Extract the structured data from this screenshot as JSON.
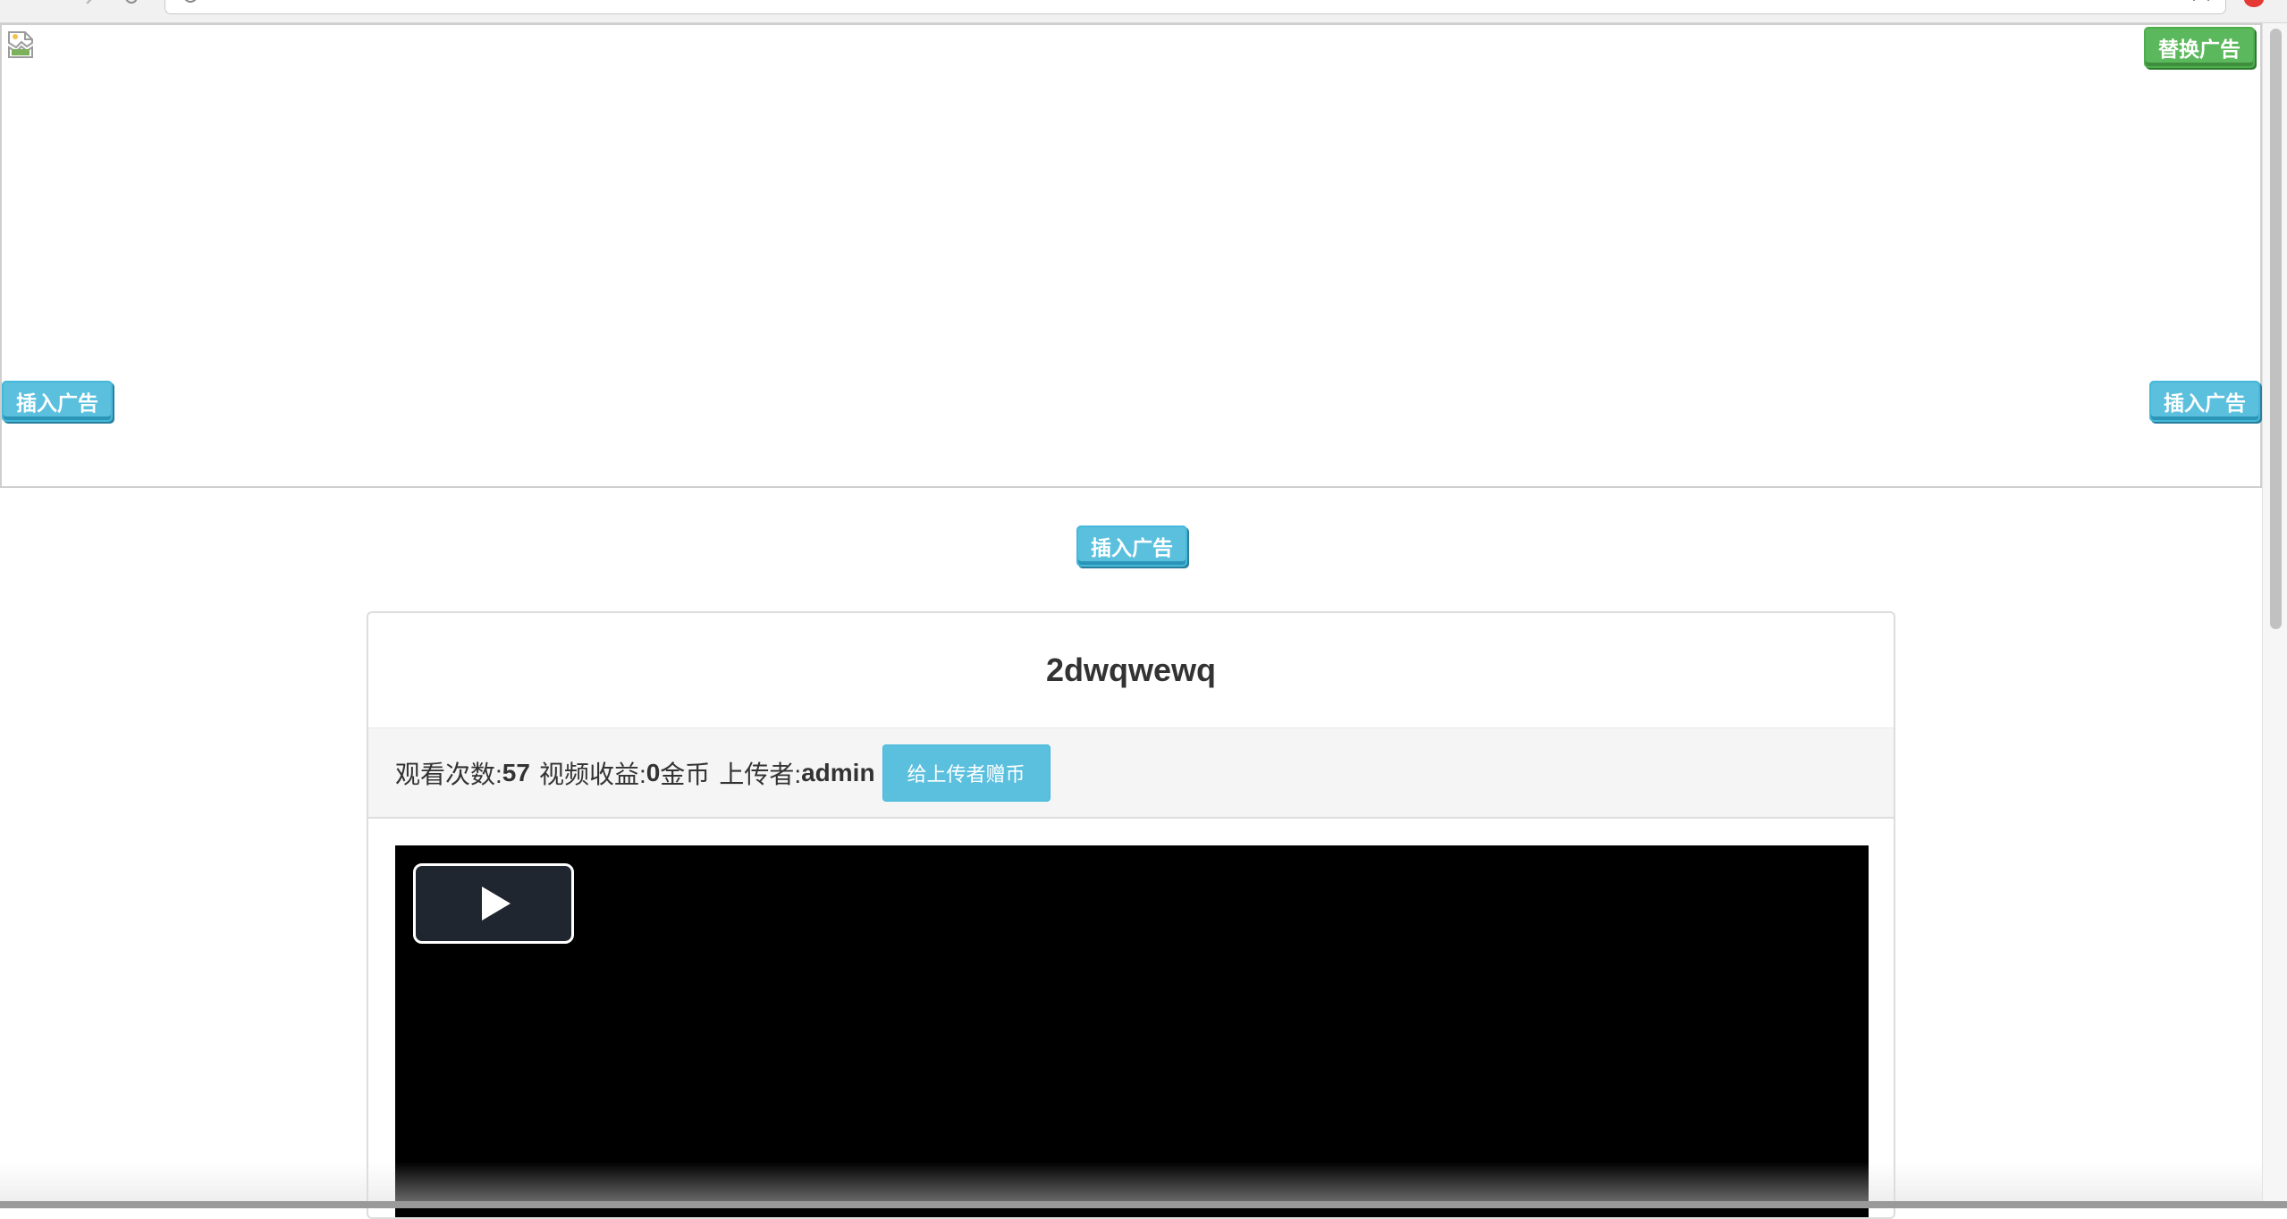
{
  "ad": {
    "replace_label": "替换广告",
    "insert_left_label": "插入广告",
    "insert_right_label": "插入广告",
    "insert_center_label": "插入广告"
  },
  "video": {
    "title": "2dwqwewq",
    "views_label": "观看次数:",
    "views_value": "57",
    "revenue_label": "视频收益:",
    "revenue_value": "0",
    "revenue_unit": "金币",
    "uploader_label": "上传者:",
    "uploader_value": "admin",
    "tip_button_label": "给上传者赠币"
  },
  "icons": {
    "broken_image": "broken-image-icon",
    "play": "play-icon"
  },
  "colors": {
    "info_button": "#5bc0de",
    "success_button": "#5cb85c",
    "player_background": "#000000"
  }
}
